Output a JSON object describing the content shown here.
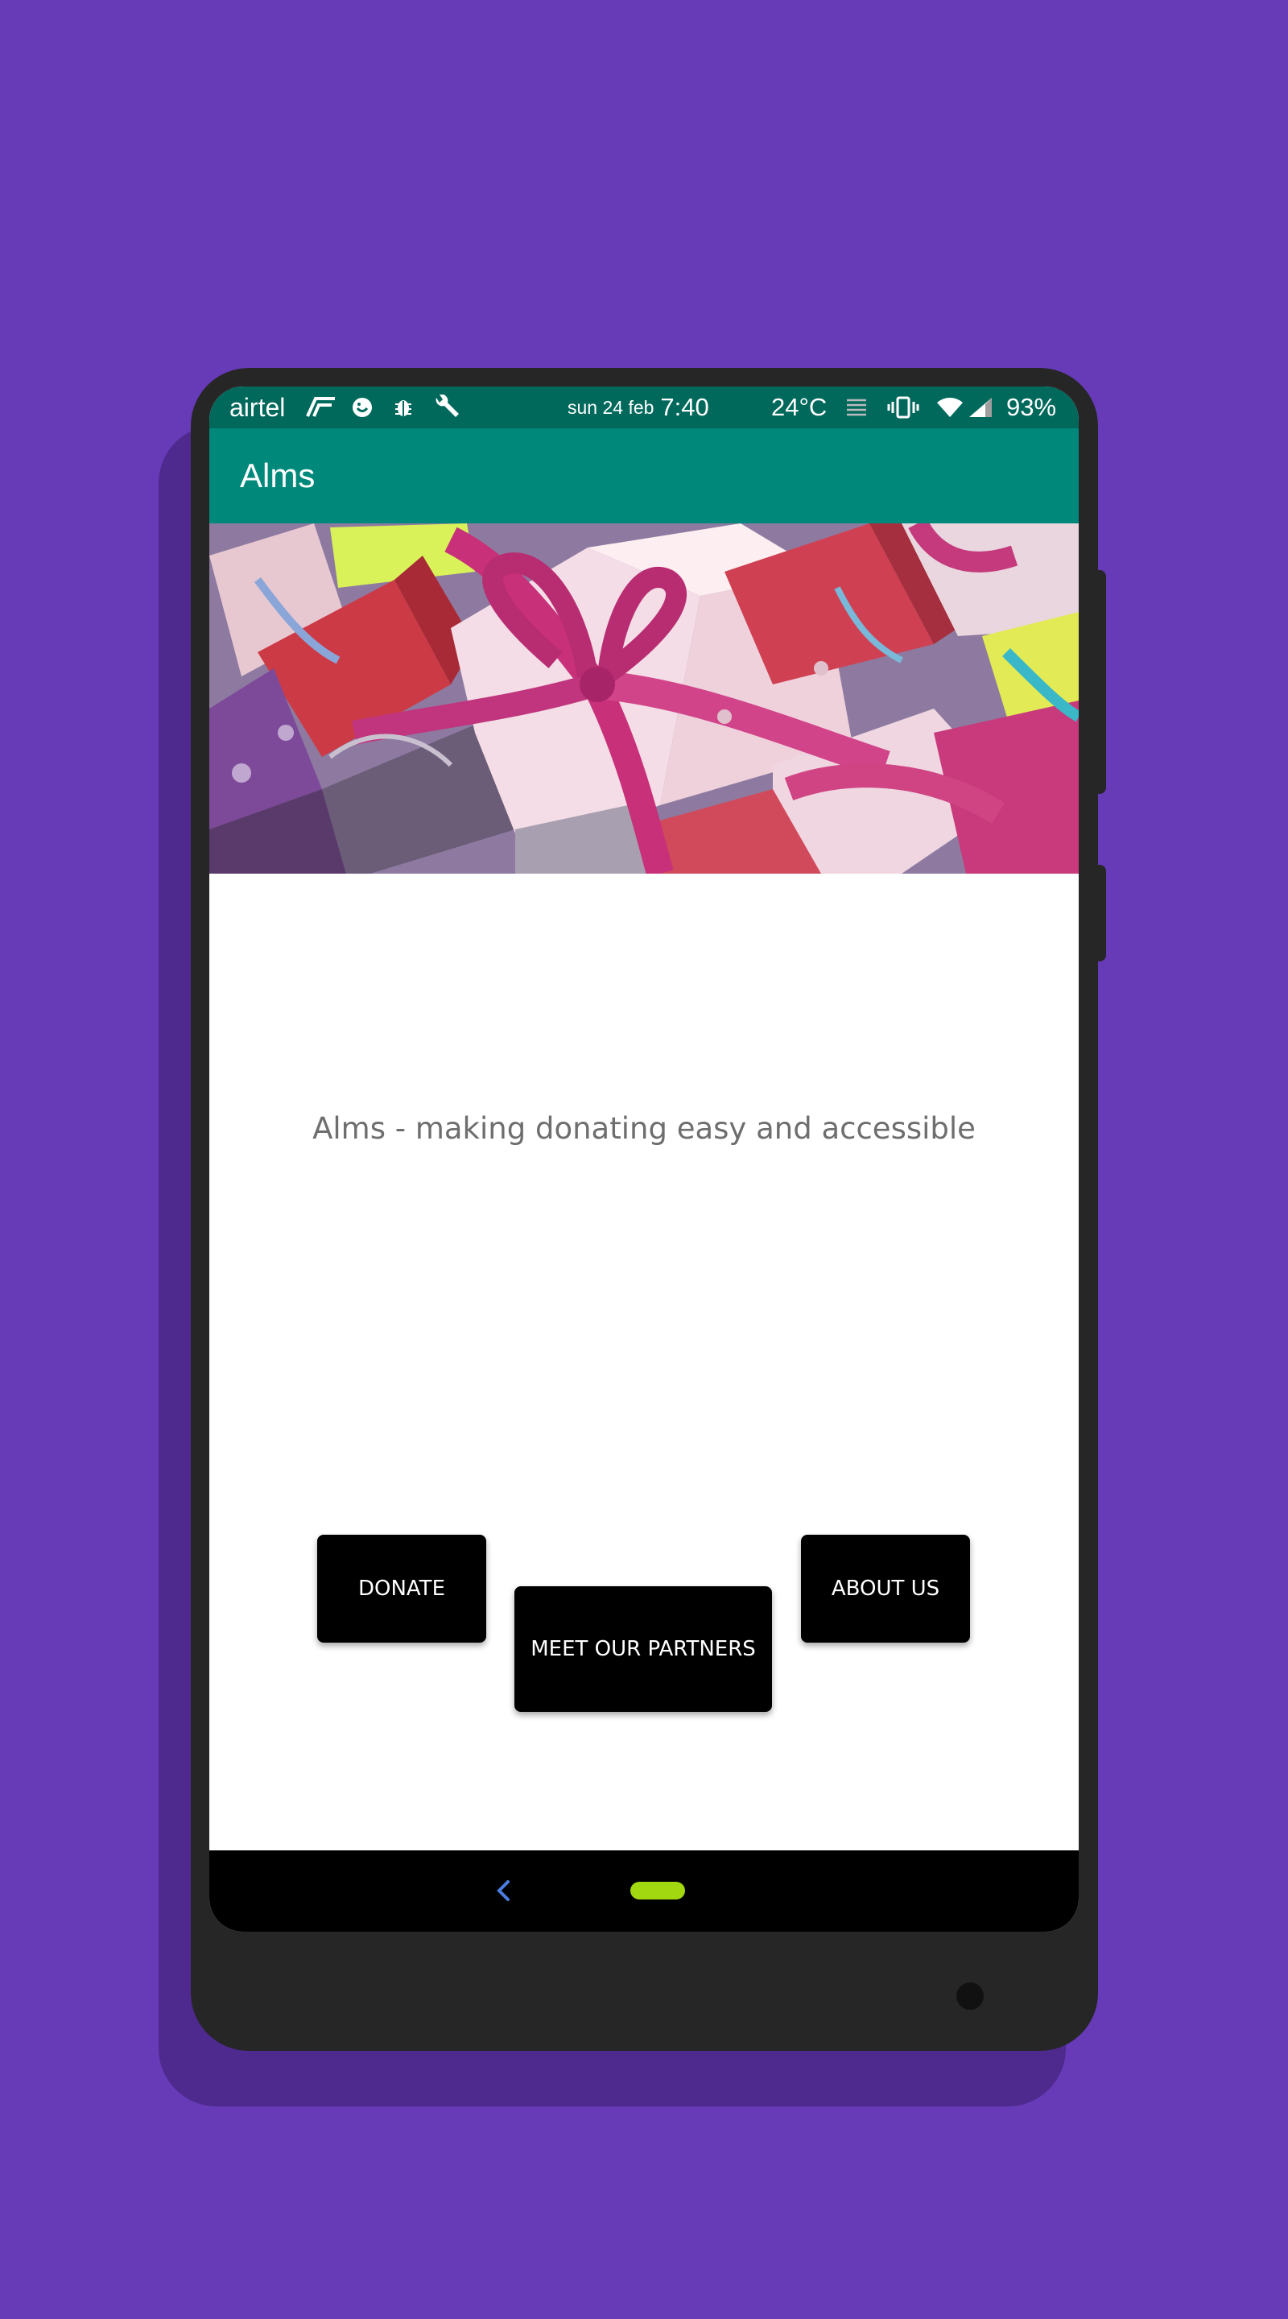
{
  "status_bar": {
    "carrier": "airtel",
    "date": "sun 24 feb",
    "time": "7:40",
    "temperature": "24°C",
    "battery": "93%",
    "icons": [
      "fast-connection-icon",
      "face-icon",
      "bug-icon",
      "wrench-icon",
      "notes-icon",
      "vibrate-icon",
      "wifi-icon",
      "signal-icon"
    ]
  },
  "app_bar": {
    "title": "Alms"
  },
  "hero": {
    "image": "gift-boxes-with-pink-ribbons"
  },
  "main": {
    "tagline": "Alms - making donating easy and accessible",
    "buttons": {
      "donate": "DONATE",
      "partners": "MEET OUR PARTNERS",
      "about": "ABOUT US"
    }
  },
  "nav_bar": {
    "icons": [
      "back-icon",
      "home-pill-icon"
    ]
  },
  "colors": {
    "background": "#673ab7",
    "status_bar": "#00695c",
    "app_bar": "#00897b",
    "button": "#000000",
    "home_pill": "#a2d80f"
  }
}
